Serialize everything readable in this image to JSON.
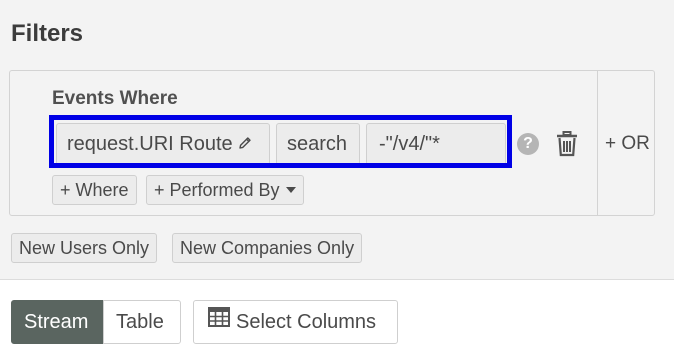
{
  "filters": {
    "title": "Filters",
    "events_where_label": "Events Where",
    "condition": {
      "field": "request.URI Route",
      "operator": "search",
      "value": "-\"/v4/\"*"
    },
    "help_icon": "question-circle-icon",
    "delete_icon": "trash-icon",
    "or_label": "+ OR",
    "add_where_label": "+ Where",
    "add_performed_by_label": "+ Performed By",
    "highlight_color": "#0000e6"
  },
  "user_filters": {
    "new_users_label": "New Users Only",
    "new_companies_label": "New Companies Only"
  },
  "view_toggle": {
    "stream_label": "Stream",
    "table_label": "Table",
    "active": "Stream",
    "active_color": "#5a6560"
  },
  "select_columns_label": "Select Columns"
}
